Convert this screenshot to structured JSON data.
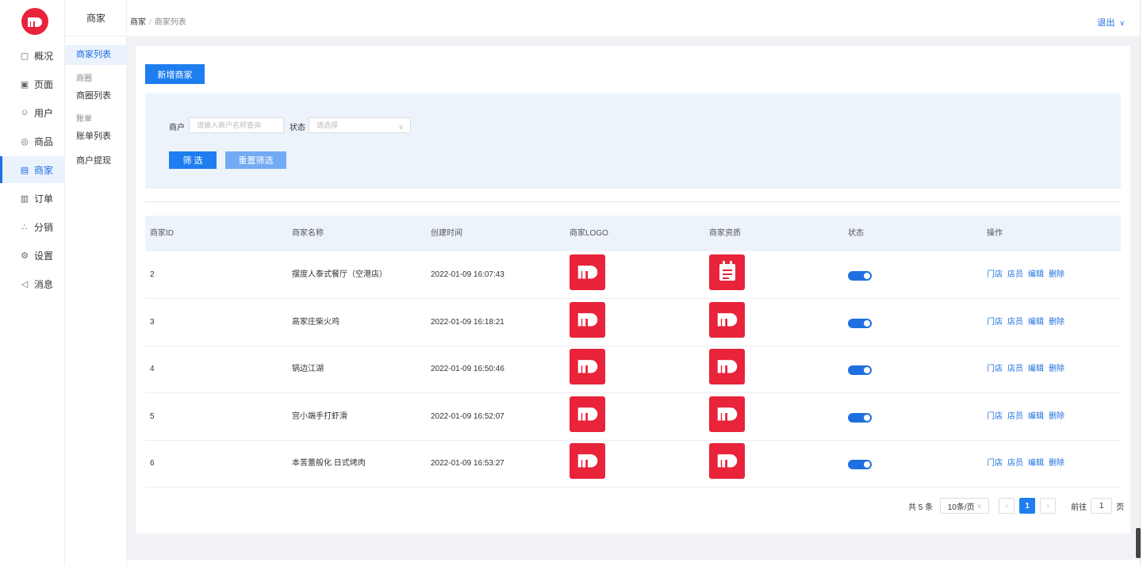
{
  "rail": {
    "items": [
      {
        "label": "概况",
        "icon": "monitor-icon"
      },
      {
        "label": "页面",
        "icon": "page-icon"
      },
      {
        "label": "用户",
        "icon": "user-icon"
      },
      {
        "label": "商品",
        "icon": "goods-icon"
      },
      {
        "label": "商家",
        "icon": "store-icon",
        "active": true
      },
      {
        "label": "订单",
        "icon": "order-icon"
      },
      {
        "label": "分销",
        "icon": "distribution-icon"
      },
      {
        "label": "设置",
        "icon": "settings-icon"
      },
      {
        "label": "消息",
        "icon": "message-icon"
      }
    ]
  },
  "sub": {
    "title": "商家",
    "list": "商家列表",
    "group1": "商圈",
    "circle_list": "商圈列表",
    "group2": "账单",
    "bill_list": "账单列表",
    "withdraw": "商户提现"
  },
  "topbar": {
    "crumb_root": "商家",
    "crumb_sep": "/",
    "crumb_current": "商家列表",
    "logout": "退出"
  },
  "toolbar": {
    "add_label": "新增商家"
  },
  "filter": {
    "merchant_label": "商户",
    "merchant_placeholder": "请输入商户名称查询",
    "status_label": "状态",
    "status_placeholder": "请选择",
    "filter_btn": "筛 选",
    "reset_btn": "重置筛选"
  },
  "table": {
    "headers": [
      "商家ID",
      "商家名称",
      "创建时间",
      "商家LOGO",
      "商家资质",
      "状态",
      "操作"
    ],
    "ops": [
      "门店",
      "店员",
      "编辑",
      "删除"
    ],
    "rows": [
      {
        "id": "2",
        "name": "摆度人泰式餐厅（空港店）",
        "time": "2022-01-09 16:07:43",
        "license": "calendar-icon",
        "enabled": true
      },
      {
        "id": "3",
        "name": "高家庄柴火鸡",
        "time": "2022-01-09 16:18:21",
        "license": "brand-logo",
        "enabled": true
      },
      {
        "id": "4",
        "name": "锅边江湖",
        "time": "2022-01-09 16:50:46",
        "license": "brand-logo",
        "enabled": true
      },
      {
        "id": "5",
        "name": "宫小端手打虾滑",
        "time": "2022-01-09 16:52:07",
        "license": "brand-logo",
        "enabled": true
      },
      {
        "id": "6",
        "name": "本苦蕾般化 日式烤肉",
        "time": "2022-01-09 16:53:27",
        "license": "brand-logo",
        "enabled": true
      }
    ]
  },
  "pager": {
    "total": "共 5 条",
    "page_size": "10条/页",
    "current": "1",
    "goto_label": "前往",
    "goto_value": "1",
    "page_suffix": "页"
  },
  "colors": {
    "brand_red": "#e8233a",
    "primary": "#1e7ef0",
    "active_text": "#1e6fe0"
  }
}
